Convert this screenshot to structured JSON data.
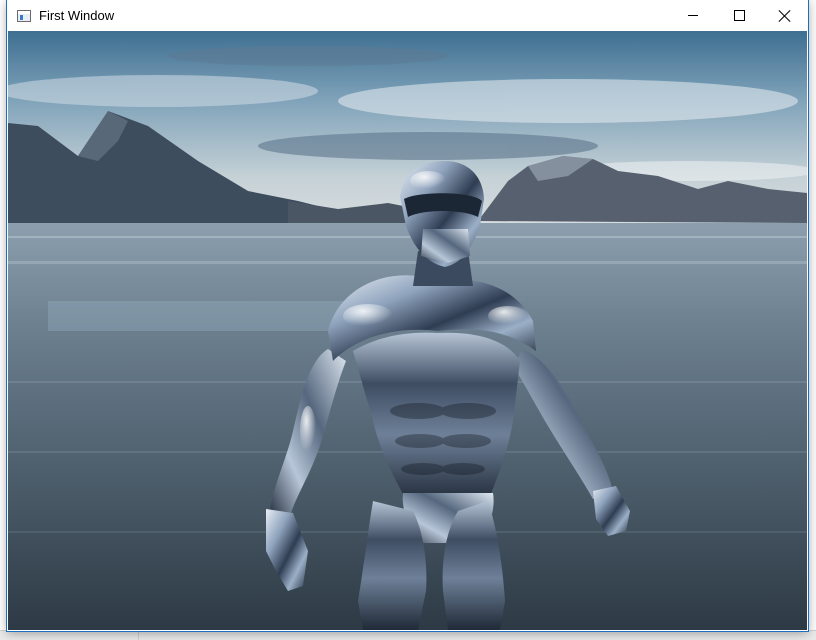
{
  "window": {
    "title": "First Window",
    "controls": {
      "minimize": "minimize",
      "maximize": "maximize",
      "close": "close"
    }
  },
  "scene": {
    "sky_top": "#3d6f92",
    "sky_bottom": "#c9d4d6",
    "water": "#5c7080",
    "mountains": "#4a5568"
  },
  "icons": [
    "app-icon",
    "minimize-icon",
    "maximize-icon",
    "close-icon"
  ]
}
